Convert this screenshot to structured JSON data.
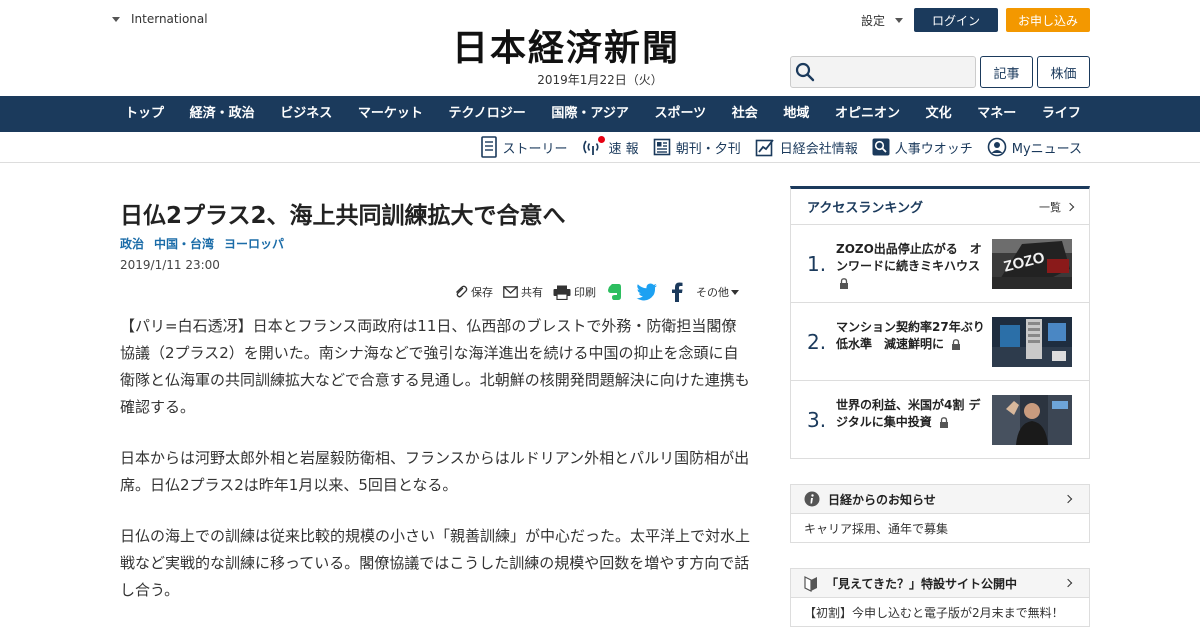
{
  "header": {
    "edition": "International",
    "logo_text": "日本経済新聞",
    "date": "2019年1月22日（火）",
    "settings_label": "設定",
    "login_label": "ログイン",
    "signup_label": "お申し込み",
    "article_search_label": "記事",
    "stock_label": "株価"
  },
  "nav": {
    "items": [
      "トップ",
      "経済・政治",
      "ビジネス",
      "マーケット",
      "テクノロジー",
      "国際・アジア",
      "スポーツ",
      "社会",
      "地域",
      "オピニオン",
      "文化",
      "マネー",
      "ライフ"
    ]
  },
  "subnav": {
    "items": [
      {
        "label": "ストーリー",
        "icon": "document-icon"
      },
      {
        "label": "速 報",
        "icon": "signal-icon"
      },
      {
        "label": "朝刊・夕刊",
        "icon": "newspaper-icon"
      },
      {
        "label": "日経会社情報",
        "icon": "chart-icon"
      },
      {
        "label": "人事ウオッチ",
        "icon": "magnifier-icon"
      },
      {
        "label": "Myニュース",
        "icon": "person-icon"
      }
    ]
  },
  "article": {
    "headline": "日仏2プラス2、海上共同訓練拡大で合意へ",
    "tags": [
      "政治",
      "中国・台湾",
      "ヨーロッパ"
    ],
    "date": "2019/1/11 23:00",
    "share": {
      "save": "保存",
      "share": "共有",
      "print": "印刷",
      "more": "その他"
    },
    "paragraphs": [
      "【パリ=白石透冴】日本とフランス両政府は11日、仏西部のブレストで外務・防衛担当閣僚協議（2プラス2）を開いた。南シナ海などで強引な海洋進出を続ける中国の抑止を念頭に自衛隊と仏海軍の共同訓練拡大などで合意する見通し。北朝鮮の核開発問題解決に向けた連携も確認する。",
      "日本からは河野太郎外相と岩屋毅防衛相、フランスからはルドリアン外相とパルリ国防相が出席。日仏2プラス2は昨年1月以来、5回目となる。",
      "日仏の海上での訓練は従来比較的規模の小さい「親善訓練」が中心だった。太平洋上で対水上戦など実戦的な訓練に移っている。閣僚協議ではこうした訓練の規模や回数を増やす方向で話し合う。"
    ]
  },
  "ranking": {
    "title": "アクセスランキング",
    "more_label": "一覧",
    "items": [
      {
        "rank": "1.",
        "title": "ZOZO出品停止広がる　オンワードに続きミキハウス"
      },
      {
        "rank": "2.",
        "title": "マンション契約率27年ぶり低水準　減速鮮明に"
      },
      {
        "rank": "3.",
        "title": "世界の利益、米国が4割 デジタルに集中投資"
      }
    ]
  },
  "notices": [
    {
      "title": "日経からのお知らせ",
      "body": "キャリア採用、通年で募集"
    },
    {
      "title": "「見えてきた？」特設サイト公開中",
      "body": "【初割】今申し込むと電子版が2月末まで無料！"
    }
  ],
  "colors": {
    "navy": "#1b3a5c",
    "orange": "#f39800",
    "link_blue": "#1b6ca8",
    "breaking_red": "#e60012"
  }
}
